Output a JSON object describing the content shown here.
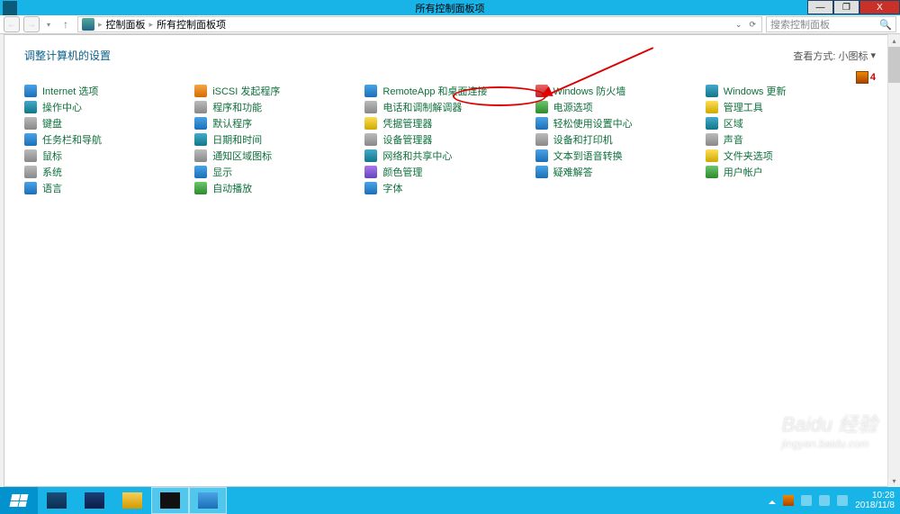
{
  "window": {
    "title": "所有控制面板项",
    "minimize": "—",
    "maximize": "❐",
    "close": "X"
  },
  "toolbar": {
    "nav_back": "←",
    "nav_fwd": "→",
    "nav_drop": "▾",
    "nav_up": "↑",
    "breadcrumb_root": "控制面板",
    "breadcrumb_current": "所有控制面板项",
    "bc_sep": "▸",
    "addr_drop": "⌄",
    "addr_refresh": "⟳",
    "search_placeholder": "搜索控制面板",
    "search_icon": "🔍"
  },
  "heading": "调整计算机的设置",
  "viewby": {
    "label": "查看方式:",
    "value": "小图标",
    "arrow": "▾"
  },
  "notification": {
    "count": "4"
  },
  "items": [
    {
      "label": "Internet 选项",
      "ic": "ic-blue"
    },
    {
      "label": "iSCSI 发起程序",
      "ic": "ic-orange"
    },
    {
      "label": "RemoteApp 和桌面连接",
      "ic": "ic-blue"
    },
    {
      "label": "Windows 防火墙",
      "ic": "ic-red"
    },
    {
      "label": "Windows 更新",
      "ic": "ic-teal"
    },
    {
      "label": "操作中心",
      "ic": "ic-teal"
    },
    {
      "label": "程序和功能",
      "ic": "ic-gray"
    },
    {
      "label": "电话和调制解调器",
      "ic": "ic-gray"
    },
    {
      "label": "电源选项",
      "ic": "ic-green"
    },
    {
      "label": "管理工具",
      "ic": "ic-yellow"
    },
    {
      "label": "键盘",
      "ic": "ic-gray"
    },
    {
      "label": "默认程序",
      "ic": "ic-blue"
    },
    {
      "label": "凭据管理器",
      "ic": "ic-yellow"
    },
    {
      "label": "轻松使用设置中心",
      "ic": "ic-blue"
    },
    {
      "label": "区域",
      "ic": "ic-teal"
    },
    {
      "label": "任务栏和导航",
      "ic": "ic-blue"
    },
    {
      "label": "日期和时间",
      "ic": "ic-teal"
    },
    {
      "label": "设备管理器",
      "ic": "ic-gray"
    },
    {
      "label": "设备和打印机",
      "ic": "ic-gray"
    },
    {
      "label": "声音",
      "ic": "ic-gray"
    },
    {
      "label": "鼠标",
      "ic": "ic-gray"
    },
    {
      "label": "通知区域图标",
      "ic": "ic-gray"
    },
    {
      "label": "网络和共享中心",
      "ic": "ic-teal"
    },
    {
      "label": "文本到语音转换",
      "ic": "ic-blue"
    },
    {
      "label": "文件夹选项",
      "ic": "ic-yellow"
    },
    {
      "label": "系统",
      "ic": "ic-gray"
    },
    {
      "label": "显示",
      "ic": "ic-blue"
    },
    {
      "label": "颜色管理",
      "ic": "ic-purple"
    },
    {
      "label": "疑难解答",
      "ic": "ic-blue"
    },
    {
      "label": "用户帐户",
      "ic": "ic-green"
    },
    {
      "label": "语言",
      "ic": "ic-blue"
    },
    {
      "label": "自动播放",
      "ic": "ic-green"
    },
    {
      "label": "字体",
      "ic": "ic-blue"
    }
  ],
  "taskbar": {
    "tray_caret": "▴"
  },
  "clock": {
    "time": "10:28",
    "date": "2018/11/8"
  },
  "watermark": {
    "brand": "Baidu 经验",
    "sub": "jingyan.baidu.com"
  }
}
